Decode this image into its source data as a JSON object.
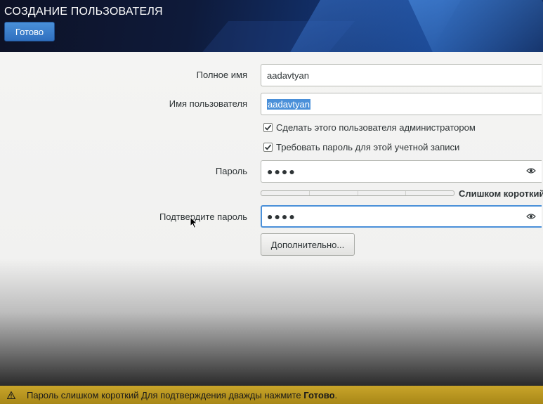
{
  "header": {
    "title": "СОЗДАНИЕ ПОЛЬЗОВАТЕЛЯ",
    "done_label": "Готово"
  },
  "form": {
    "fullname_label": "Полное имя",
    "fullname_value": "aadavtyan",
    "username_label": "Имя пользователя",
    "username_value": "aadavtyan",
    "admin_checkbox_label": "Сделать этого пользователя администратором",
    "admin_checked": true,
    "require_password_label": "Требовать пароль для этой учетной записи",
    "require_password_checked": true,
    "password_label": "Пароль",
    "password_value": "●●●●",
    "strength_text": "Слишком короткий",
    "strength_level": 0,
    "confirm_label": "Подтвердите пароль",
    "confirm_value": "●●●●",
    "advanced_label": "Дополнительно..."
  },
  "status": {
    "text": "Пароль слишком короткий Для подтверждения дважды нажмите",
    "bold": "Готово",
    "suffix": "."
  },
  "icons": {
    "password_reveal": "eye-icon",
    "confirm_reveal": "eye-icon",
    "status": "warning-icon"
  },
  "colors": {
    "accent": "#4a90d9",
    "warning_bar": "#b8961f"
  }
}
